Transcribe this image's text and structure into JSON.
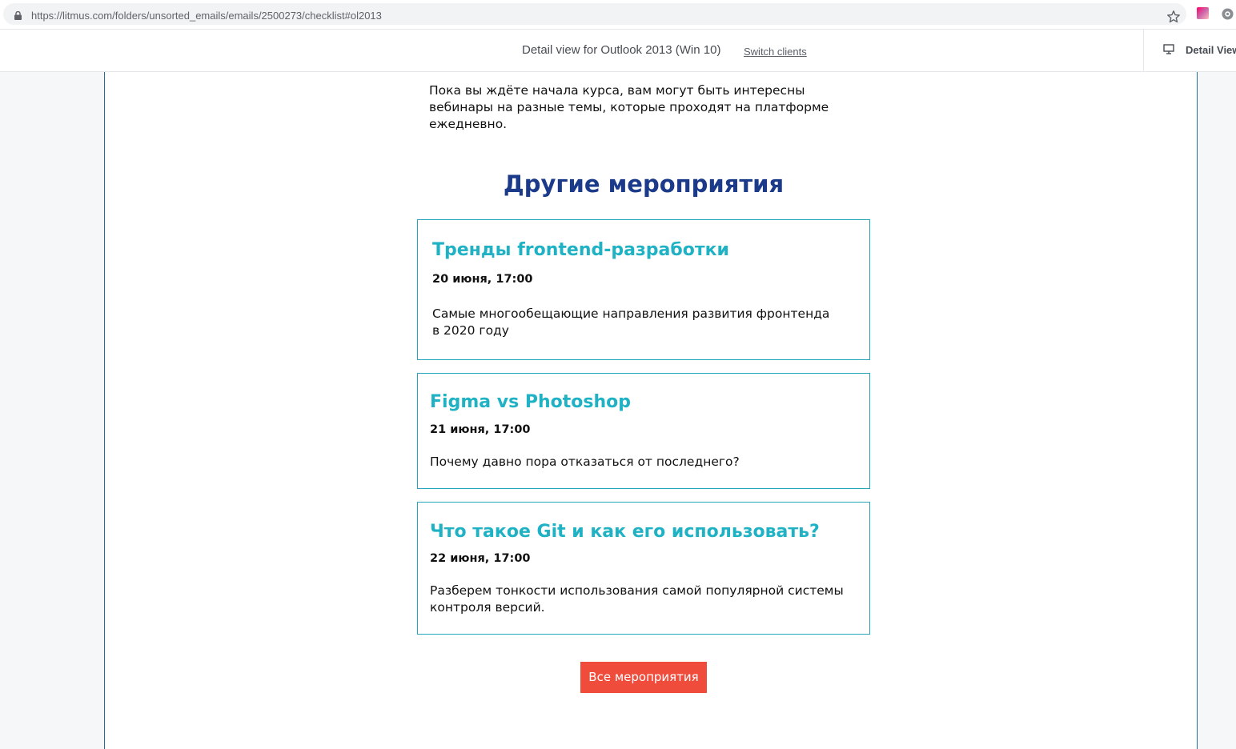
{
  "browser": {
    "url": "https://litmus.com/folders/unsorted_emails/emails/2500273/checklist#ol2013"
  },
  "header": {
    "title": "Detail view for Outlook 2013 (Win 10)",
    "switch_label": "Switch clients",
    "detail_tab_label": "Detail View"
  },
  "email": {
    "intro": "Пока вы ждёте начала курса, вам могут быть интересны вебинары на разные темы, которые проходят на платформе ежедневно.",
    "section_title": "Другие мероприятия",
    "events": [
      {
        "title": "Тренды frontend-разработки",
        "date": "20 июня, 17:00",
        "description": "Самые многообещающие направления развития фронтенда в 2020 году"
      },
      {
        "title": "Figma vs Photoshop",
        "date": "21 июня, 17:00",
        "description": "Почему давно пора отказаться от последнего?"
      },
      {
        "title": "Что такое Git и как его использовать?",
        "date": "22 июня, 17:00",
        "description": "Разберем тонкости использования самой популярной системы контроля версий."
      }
    ],
    "cta_label": "Все мероприятия"
  },
  "colors": {
    "heading": "#1b3a8a",
    "event_title": "#1fb2c4",
    "card_border": "#24a7b8",
    "cta_background": "#f04c3c"
  },
  "icons": [
    "lock-icon",
    "star-icon",
    "extension-icon",
    "settings-icon",
    "monitor-icon"
  ]
}
